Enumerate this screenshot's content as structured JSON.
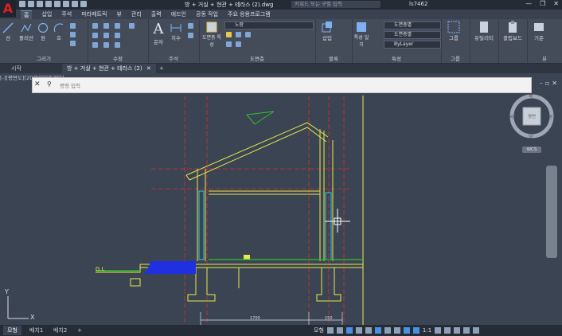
{
  "app": {
    "logo": "A",
    "title": "방 + 거실 + 현관 + 테라스 (2).dwg",
    "search_placeholder": "키워드 또는 구절 입력",
    "user": "ls7462"
  },
  "menu": [
    "홈",
    "삽입",
    "주석",
    "파라메트릭",
    "뷰",
    "관리",
    "출력",
    "애드인",
    "공동 작업",
    "주요 응용프로그램"
  ],
  "ribbon": {
    "draw": {
      "title": "그리기",
      "line": "선",
      "polyline": "폴리선",
      "circle": "원",
      "arc": "호"
    },
    "modify": {
      "title": "수정"
    },
    "annotation": {
      "title": "주석",
      "text": "문자",
      "dimension": "치수"
    },
    "layers": {
      "title": "도면층",
      "layer_props": "도면층\n특성",
      "current_layer": "노랑"
    },
    "block": {
      "title": "블록",
      "insert": "삽입"
    },
    "properties": {
      "title": "특성",
      "match": "특성\n일치",
      "color": "도면층별",
      "linetype": "도면층별",
      "lineweight": "ByLayer"
    },
    "groups": {
      "title": "그룹",
      "group": "그룹"
    },
    "utilities": {
      "title": "유틸리티"
    },
    "clipboard": {
      "title": "클립보드"
    },
    "view": {
      "title": "뷰",
      "base": "기준"
    }
  },
  "tabs": [
    {
      "label": "시작"
    },
    {
      "label": "방 + 거실 + 현관 + 테라스 (2)"
    }
  ],
  "viewport_label": "[-][평면도][2D와이어프레임]",
  "command": {
    "placeholder": "명령 입력"
  },
  "viewcube": {
    "face": "평면",
    "wcs": "WCS",
    "n": "북",
    "s": "남",
    "e": "동",
    "w": "서"
  },
  "drawing": {
    "gl_label": "G.L",
    "dim_left": "1700",
    "dim_right": "150"
  },
  "ucs": {
    "x": "X",
    "y": "Y"
  },
  "layout_tabs": [
    "모형",
    "배치1",
    "배치2"
  ],
  "status": {
    "model": "모형",
    "scale": "1:1"
  },
  "colors": {
    "yellow": "#e8e84a",
    "red_dash": "#d83030",
    "cyan": "#30c8d8",
    "blue": "#2030e0",
    "green": "#30c030",
    "bg": "#3b4453"
  }
}
